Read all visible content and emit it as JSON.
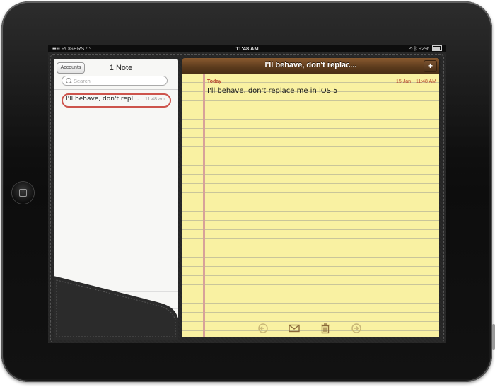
{
  "statusbar": {
    "carrier": "ROGERS",
    "time": "11:48 AM",
    "battery": "92%"
  },
  "notes_list": {
    "accounts_label": "Accounts",
    "title": "1 Note",
    "search_placeholder": "Search",
    "items": [
      {
        "title": "I'll behave, don't repl...",
        "time": "11:48 am"
      }
    ]
  },
  "note": {
    "header_title": "I'll behave, don't replac...",
    "add_label": "+",
    "day_label": "Today",
    "date": "15 Jan",
    "time": "11:48 AM",
    "body": "I'll behave, don't replace me in iOS 5!!"
  },
  "toolbar": {
    "icons": [
      "previous-icon",
      "mail-icon",
      "trash-icon",
      "next-icon"
    ]
  },
  "colors": {
    "paper": "#f9f1a2",
    "header_leather": "#5a3a1c",
    "date_red": "#b5432c",
    "highlight": "#c8413a"
  }
}
